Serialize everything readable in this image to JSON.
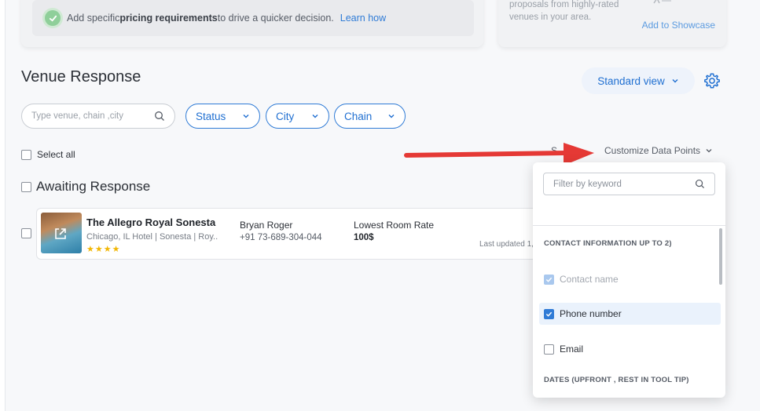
{
  "top_banner": {
    "prefix": "Add specific ",
    "bold": "pricing requirements",
    "suffix": " to drive a quicker decision.",
    "link": "Learn how"
  },
  "showcase_card": {
    "text": "proposals from highly-rated venues in your area.",
    "link": "Add to Showcase"
  },
  "section": {
    "title": "Venue Response",
    "view_label": "Standard view"
  },
  "search": {
    "placeholder": "Type venue, chain ,city"
  },
  "filters": [
    {
      "label": "Status"
    },
    {
      "label": "City"
    },
    {
      "label": "Chain"
    }
  ],
  "select_all_label": "Select all",
  "sort_partial": "S",
  "customize_label": "Customize Data Points",
  "group": {
    "title": "Awaiting Response"
  },
  "venue_row": {
    "name": "The Allegro Royal Sonesta",
    "sub": "Chicago, IL Hotel | Sonesta | Roy..",
    "stars": "★★★★",
    "contact_name": "Bryan Roger",
    "contact_phone": "+91 73-689-304-044",
    "rate_label": "Lowest Room Rate",
    "rate_value": "100$",
    "updated": "Last updated 1,"
  },
  "dropdown": {
    "filter_placeholder": "Filter by keyword",
    "contact_heading": "CONTACT INFORMATION  UP TO 2)",
    "items": [
      {
        "label": "Contact name",
        "state": "checked-disabled"
      },
      {
        "label": "Phone number",
        "state": "checked"
      },
      {
        "label": "Email",
        "state": "unchecked"
      }
    ],
    "dates_heading": "DATES (UPFRONT , REST IN TOOL TIP)"
  },
  "colors": {
    "accent": "#2f7bd6",
    "arrow": "#e53935",
    "star": "#f2b705"
  }
}
